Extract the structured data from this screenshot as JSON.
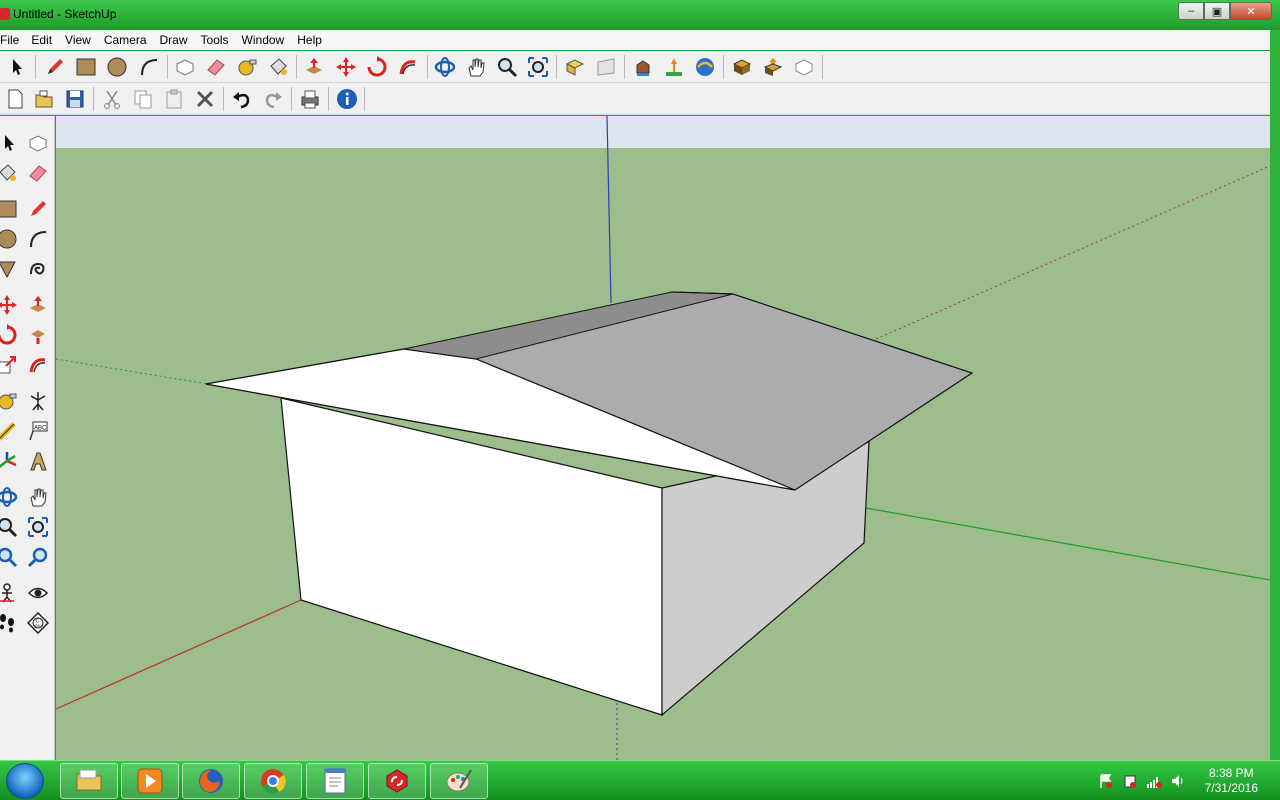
{
  "window": {
    "title": "Untitled - SketchUp"
  },
  "menu": [
    "File",
    "Edit",
    "View",
    "Camera",
    "Draw",
    "Tools",
    "Window",
    "Help"
  ],
  "toolbar_top": {
    "icons": [
      "select-icon",
      "pencil-icon",
      "rectangle-icon",
      "circle-icon",
      "arc-icon",
      "make-component-icon",
      "eraser-icon",
      "tape-measure-icon",
      "paint-bucket-icon",
      "push-pull-icon",
      "move-icon",
      "rotate-icon",
      "follow-me-icon",
      "orbit-icon",
      "pan-icon",
      "zoom-icon",
      "zoom-extents-icon",
      "previous-view-icon",
      "next-view-icon",
      "get-models-icon",
      "place-model-icon",
      "share-model-icon",
      "get-photo-icon",
      "share-component-icon",
      "component-icon"
    ]
  },
  "toolbar_second": {
    "icons": [
      "new-icon",
      "open-icon",
      "save-icon",
      "cut-icon",
      "copy-icon",
      "paste-icon",
      "erase-icon",
      "undo-icon",
      "redo-icon",
      "print-icon",
      "model-info-icon"
    ]
  },
  "left_toolbar": {
    "icons": [
      "select-icon",
      "make-component-icon",
      "paint-bucket-icon",
      "eraser-icon",
      "rectangle-icon",
      "line-icon",
      "circle-icon",
      "arc-icon",
      "polygon-icon",
      "freehand-icon",
      "move-icon",
      "push-pull-icon",
      "rotate-icon",
      "follow-me-icon",
      "scale-icon",
      "offset-icon",
      "tape-measure-icon",
      "dimension-icon",
      "protractor-icon",
      "text-icon",
      "axes-icon",
      "3d-text-icon",
      "orbit-icon",
      "pan-icon",
      "zoom-icon",
      "zoom-window-icon",
      "zoom-extents-icon",
      "previous-icon",
      "position-camera-icon",
      "look-around-icon",
      "walk-icon",
      "section-plane-icon"
    ]
  },
  "taskbar": {
    "apps": [
      "windows-explorer-icon",
      "media-player-icon",
      "firefox-icon",
      "chrome-icon",
      "text-editor-icon",
      "sketchup-icon",
      "paint-icon"
    ]
  },
  "tray": {
    "time": "8:38 PM",
    "date": "7/31/2016"
  },
  "colors": {
    "sky": "#dde6ef",
    "ground": "#9dbd8d",
    "taskbar": "#1fa32a",
    "axis_red": "#c0302c",
    "axis_green": "#1e9c2a",
    "axis_blue": "#2c3fb8"
  }
}
